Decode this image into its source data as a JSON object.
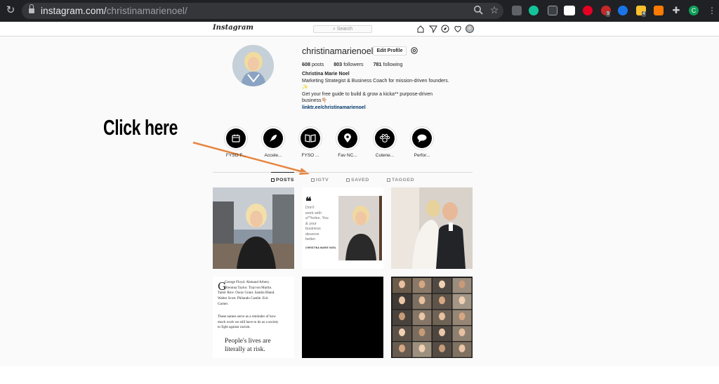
{
  "browser": {
    "url_host": "instagram.com/",
    "url_path": "christinamarienoel/"
  },
  "header": {
    "logo": "Instagram",
    "search_placeholder": "Search"
  },
  "profile": {
    "username": "christinamarienoel",
    "edit_label": "Edit Profile",
    "stats": [
      {
        "num": "608",
        "label": "posts"
      },
      {
        "num": "803",
        "label": "followers"
      },
      {
        "num": "781",
        "label": "following"
      }
    ],
    "bio": {
      "name": "Christina Marie Noel",
      "line1": "Marketing Strategist & Business Coach for mission-driven founders.",
      "line2": "✨",
      "line3": "Get your free guide to build & grow a kicka** purpose-driven",
      "line4": "business👇🏼",
      "link": "linktr.ee/christinamarienoel"
    }
  },
  "annotation": {
    "callout": "Click here",
    "arrow_color": "#e8853f"
  },
  "highlights": [
    {
      "label": "FYSO F...",
      "icon": "calendar-icon"
    },
    {
      "label": "Accele...",
      "icon": "rocket-icon"
    },
    {
      "label": "FYSO ...",
      "icon": "book-icon"
    },
    {
      "label": "Fav NC...",
      "icon": "map-pin-icon"
    },
    {
      "label": "Cutene...",
      "icon": "paw-icon"
    },
    {
      "label": "Perfor...",
      "icon": "chat-bubble-icon"
    }
  ],
  "tabs": [
    {
      "label": "POSTS",
      "active": true
    },
    {
      "label": "IGTV",
      "active": false
    },
    {
      "label": "SAVED",
      "active": false
    },
    {
      "label": "TAGGED",
      "active": false
    }
  ],
  "posts": {
    "quote_lines": [
      "Don't",
      "work with",
      "a**holes. You",
      "& your",
      "business",
      "deserve",
      "better."
    ],
    "quote_author": "CHRISTINA MARIE NOEL",
    "text_post_lines": [
      "George Floyd. Ahmaud Arbery.",
      "Breonna Taylor. Trayvon Martin.",
      "Tamir Rice. Oscar Grant. Sandra Bland.",
      "Walter Scott. Philando Castile. Eric",
      "Garner."
    ],
    "text_post_para": [
      "These names serve as a reminder of how",
      "much work we still have to do as a society",
      "to fight against racism."
    ],
    "text_post_big": [
      "People's lives are",
      "literally at risk."
    ]
  }
}
